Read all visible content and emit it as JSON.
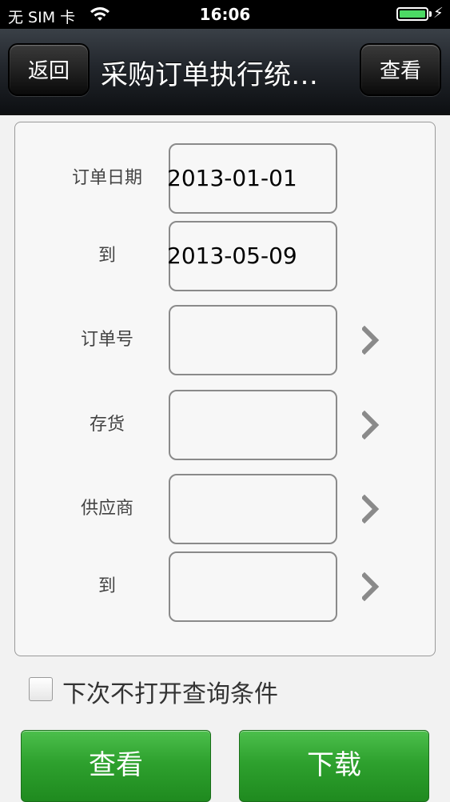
{
  "status_bar": {
    "carrier": "无 SIM 卡",
    "time": "16:06",
    "battery_level": 1.0,
    "wifi_icon": "wifi-icon",
    "charging_icon": "bolt-icon"
  },
  "nav": {
    "back_label": "返回",
    "title": "采购订单执行统…",
    "view_label": "查看"
  },
  "form": {
    "rows": [
      {
        "label": "订单日期",
        "value": "2013-01-01",
        "has_arrow": false
      },
      {
        "label": "到",
        "value": "2013-05-09",
        "has_arrow": false
      },
      {
        "label": "订单号",
        "value": "",
        "has_arrow": true
      },
      {
        "label": "存货",
        "value": "",
        "has_arrow": true
      },
      {
        "label": "供应商",
        "value": "",
        "has_arrow": true
      },
      {
        "label": "到",
        "value": "",
        "has_arrow": true
      }
    ]
  },
  "checkbox": {
    "label": "下次不打开查询条件",
    "checked": false
  },
  "buttons": {
    "view_label": "查看",
    "download_label": "下载"
  },
  "colors": {
    "accent_green": "#2ea12e",
    "battery_green": "#4cd964"
  }
}
